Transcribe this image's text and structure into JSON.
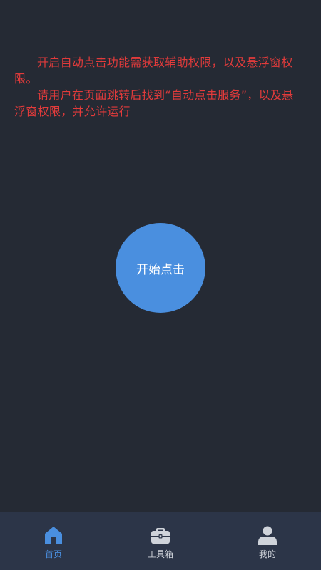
{
  "notice": {
    "paragraphs": [
      "开启自动点击功能需获取辅助权限，以及悬浮窗权限。",
      "请用户在页面跳转后找到“自动点击服务”，以及悬浮窗权限，并允许运行"
    ],
    "color": "#e23b3b"
  },
  "main": {
    "start_button_label": "开始点击",
    "button_color": "#4a8fdf"
  },
  "tabbar": {
    "items": [
      {
        "label": "首页",
        "icon": "home-icon",
        "active": true
      },
      {
        "label": "工具箱",
        "icon": "toolbox-icon",
        "active": false
      },
      {
        "label": "我的",
        "icon": "user-icon",
        "active": false
      }
    ],
    "active_color": "#4a8fdf",
    "inactive_color": "#cfd3da"
  }
}
